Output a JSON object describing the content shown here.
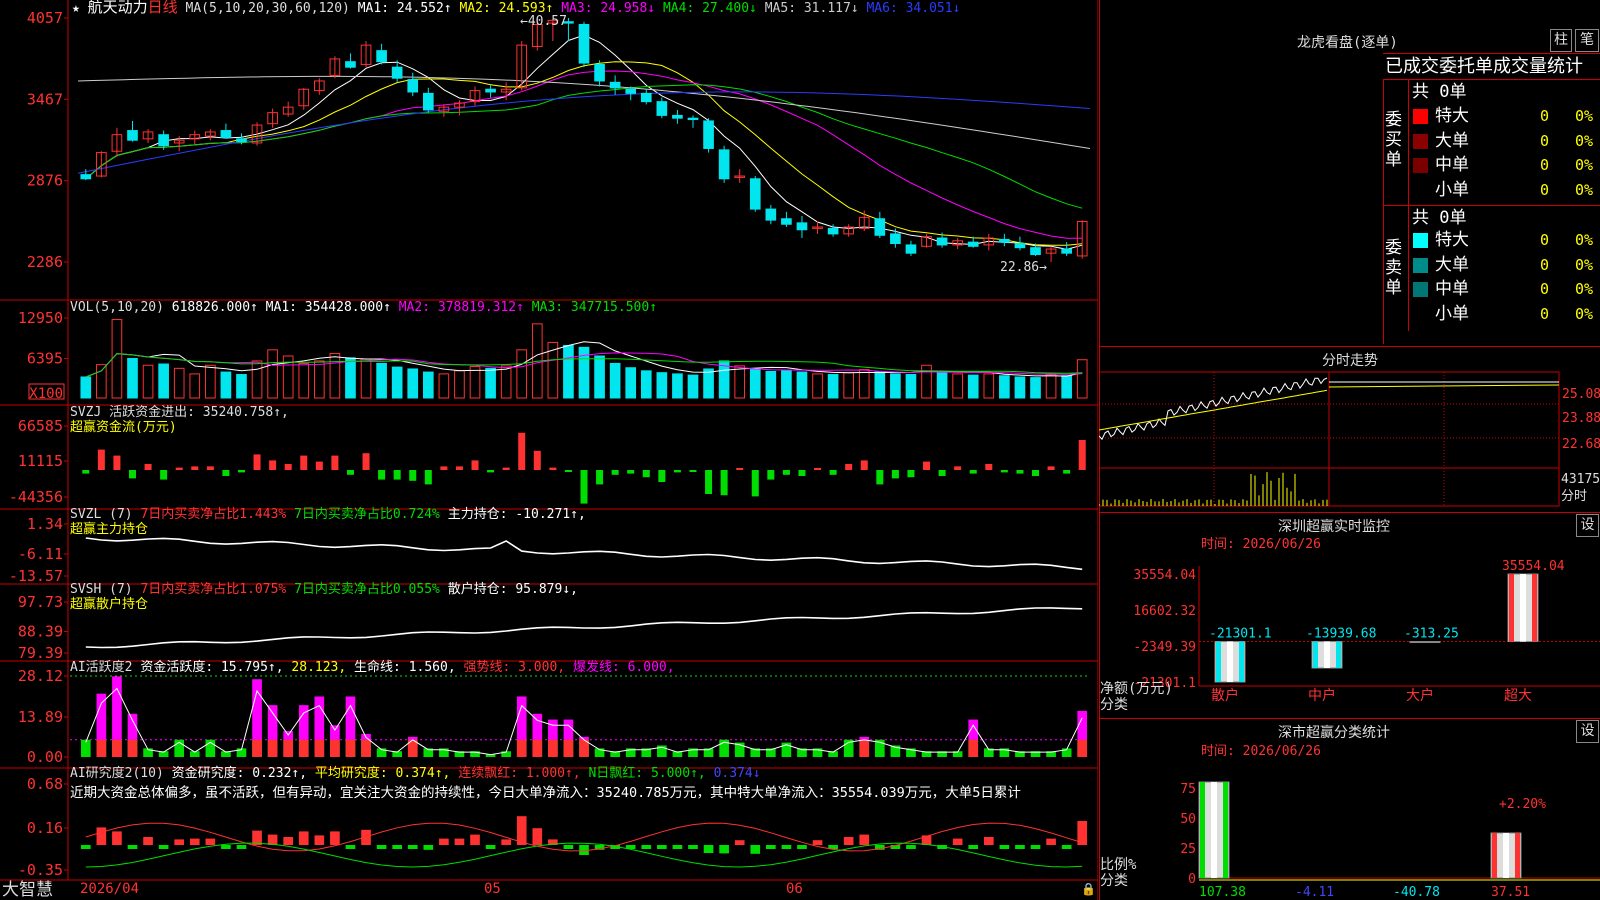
{
  "colors": {
    "up": "#ff3232",
    "down": "#00e5ee",
    "axis": "#c80000",
    "green": "#00dd00",
    "magenta": "#ff00ff",
    "yellow": "#ffff00",
    "white": "#ffffff",
    "blue": "#2a3cff"
  },
  "main": {
    "star": "★",
    "stock_name": "航天动力",
    "period": "日线",
    "ma_header": "MA(5,10,20,30,60,120)",
    "ma_values": [
      {
        "label": "MA1: 24.552↑",
        "color": "#ffffff"
      },
      {
        "label": "MA2: 24.593↑",
        "color": "#ffff00"
      },
      {
        "label": "MA3: 24.958↓",
        "color": "#ff00ff"
      },
      {
        "label": "MA4: 27.400↓",
        "color": "#00dd00"
      },
      {
        "label": "MA5: 31.117↓",
        "color": "#cccccc"
      },
      {
        "label": "MA6: 34.051↓",
        "color": "#2a3cff"
      }
    ],
    "high_annot": "←40.57",
    "low_annot": "22.86→",
    "yticks": [
      "4057",
      "3467",
      "2876",
      "2286"
    ]
  },
  "vol": {
    "header": "VOL(5,10,20)",
    "value": "618826.000↑",
    "ma": [
      {
        "label": "MA1: 354428.000↑",
        "color": "#ffffff"
      },
      {
        "label": "MA2: 378819.312↑",
        "color": "#ff00ff"
      },
      {
        "label": "MA3: 347715.500↑",
        "color": "#00dd00"
      }
    ],
    "yticks": [
      "12950",
      "6395"
    ],
    "unit": "X100"
  },
  "svzj": {
    "header": "SVZJ  活跃资金进出: 35240.758↑,",
    "sub": "超赢资金流(万元)",
    "yticks": [
      "66585",
      "11115",
      "-44356"
    ]
  },
  "svzl": {
    "header_a": "SVZL (7)",
    "header_b": "7日内买卖净占比1.443%",
    "header_c": "7日内买卖净占比0.724%",
    "header_d": "主力持仓: -10.271↑,",
    "sub": "超赢主力持仓",
    "yticks": [
      "1.34",
      "-6.11",
      "-13.57"
    ]
  },
  "svsh": {
    "header_a": "SVSH (7)",
    "header_b": "7日内买卖净占比1.075%",
    "header_c": "7日内买卖净占比0.055%",
    "header_d": "散户持仓: 95.879↓,",
    "sub": "超赢散户持仓",
    "yticks": [
      "97.73",
      "88.39",
      "79.39"
    ]
  },
  "ai1": {
    "header_a": "AI活跃度2",
    "header_b": "资金活跃度: 15.795↑,",
    "header_c": "28.123,",
    "header_d": "生命线: 1.560,",
    "header_e": "强势线: 3.000,",
    "header_f": "爆发线: 6.000,",
    "yticks": [
      "28.12",
      "13.89",
      "0.00"
    ]
  },
  "ai2": {
    "header_a": "AI研究度2(10)",
    "header_b": "资金研究度: 0.232↑,",
    "header_c": "平均研究度: 0.374↑,",
    "header_d": "连续飘红: 1.000↑,",
    "header_e": "N日飘红: 5.000↑,",
    "header_f": "0.374↓",
    "comment": "近期大资金总体偏多，虽不活跃，但有异动，宜关注大资金的持续性，今日大单净流入：35240.785万元，其中特大单净流入：35554.039万元，大单5日累计",
    "yticks": [
      "0.68",
      "0.16",
      "-0.35"
    ]
  },
  "bottom": {
    "logo": "大智慧",
    "date_labels": [
      "2026/04",
      "05",
      "06"
    ]
  },
  "right": {
    "dragon": {
      "title": "龙虎看盘(逐单)",
      "btn1": "柱",
      "btn2": "笔",
      "subtitle": "已成交委托单成交量统计",
      "buy_label": "委买单",
      "sell_label": "委卖单",
      "buy_total": "共 0单",
      "sell_total": "共 0单",
      "rows": [
        {
          "name": "特大",
          "count": "0",
          "pct": "0%"
        },
        {
          "name": "大单",
          "count": "0",
          "pct": "0%"
        },
        {
          "name": "中单",
          "count": "0",
          "pct": "0%"
        },
        {
          "name": "小单",
          "count": "0",
          "pct": "0%"
        }
      ]
    },
    "intraday": {
      "title": "分时走势",
      "yticks": [
        "25.08",
        "23.88",
        "22.68"
      ],
      "vol_label": "43175",
      "vol_unit": "分时"
    },
    "sz_monitor": {
      "title": "深圳超赢实时监控",
      "btn": "设",
      "time": "时间: 2026/06/26",
      "yticks": [
        "35554.04",
        "16602.32",
        "-2349.39",
        "-21301.1"
      ],
      "ylabel": "净额(万元)",
      "xlabel": "分类",
      "chart_data": {
        "type": "bar",
        "categories": [
          "散户",
          "中户",
          "大户",
          "超大"
        ],
        "values": [
          -21301.1,
          -13939.68,
          -313.25,
          35554.04
        ],
        "value_labels": [
          "-21301.1",
          "-13939.68",
          "-313.25",
          "35554.04"
        ],
        "ylim": [
          -21301.1,
          35554.04
        ]
      }
    },
    "sz_class": {
      "title": "深市超赢分类统计",
      "btn": "设",
      "time": "时间: 2026/06/26",
      "yticks": [
        "75",
        "50",
        "25",
        "0"
      ],
      "ylabel": "比例%",
      "xlabel": "分类",
      "pct_annot": "+2.20%",
      "chart_data": {
        "type": "bar",
        "categories": [
          "散户",
          "中户",
          "大户",
          "超大"
        ],
        "values": [
          107.38,
          -4.11,
          -40.78,
          37.51
        ],
        "value_labels": [
          "107.38",
          "-4.11",
          "-40.78",
          "37.51"
        ],
        "ylim": [
          0,
          75
        ]
      }
    }
  },
  "chart_data": {
    "type": "candlestick",
    "title": "航天动力 日线",
    "ylim": [
      22.86,
      40.57
    ],
    "annotations": [
      "←40.57",
      "22.86→"
    ],
    "x_labels": [
      "2026/04",
      "05",
      "06"
    ],
    "ohlc": [
      [
        29.2,
        29.6,
        28.8,
        28.9
      ],
      [
        29.1,
        30.9,
        29.0,
        30.8
      ],
      [
        30.9,
        32.6,
        30.5,
        32.1
      ],
      [
        32.4,
        33.1,
        31.6,
        31.7
      ],
      [
        31.8,
        32.5,
        31.5,
        32.3
      ],
      [
        32.1,
        32.4,
        31.0,
        31.3
      ],
      [
        31.5,
        32.0,
        30.9,
        31.7
      ],
      [
        31.8,
        32.4,
        31.4,
        32.1
      ],
      [
        32.0,
        32.5,
        31.7,
        32.3
      ],
      [
        32.4,
        32.9,
        31.8,
        31.9
      ],
      [
        31.8,
        32.2,
        31.4,
        31.6
      ],
      [
        31.5,
        33.0,
        31.3,
        32.8
      ],
      [
        32.9,
        34.0,
        32.6,
        33.7
      ],
      [
        33.6,
        34.5,
        33.4,
        34.1
      ],
      [
        34.2,
        35.5,
        33.9,
        35.4
      ],
      [
        35.3,
        36.2,
        35.0,
        36.0
      ],
      [
        36.4,
        37.8,
        36.2,
        37.6
      ],
      [
        37.4,
        38.0,
        36.9,
        37.0
      ],
      [
        37.2,
        38.9,
        37.0,
        38.6
      ],
      [
        38.2,
        38.7,
        37.2,
        37.4
      ],
      [
        37.0,
        37.5,
        35.9,
        36.2
      ],
      [
        36.1,
        36.6,
        34.9,
        35.2
      ],
      [
        35.1,
        35.5,
        33.7,
        33.9
      ],
      [
        33.8,
        34.3,
        33.4,
        34.1
      ],
      [
        34.1,
        34.6,
        33.5,
        34.4
      ],
      [
        34.5,
        35.6,
        34.2,
        35.3
      ],
      [
        35.4,
        35.7,
        34.8,
        35.2
      ],
      [
        35.2,
        35.9,
        34.6,
        35.4
      ],
      [
        35.5,
        38.9,
        35.3,
        38.6
      ],
      [
        38.5,
        40.3,
        38.2,
        40.1
      ],
      [
        40.2,
        40.5,
        38.9,
        40.4
      ],
      [
        40.3,
        40.57,
        38.9,
        40.2
      ],
      [
        40.1,
        40.3,
        37.0,
        37.3
      ],
      [
        37.2,
        37.5,
        35.6,
        36.0
      ],
      [
        35.9,
        36.4,
        35.0,
        35.5
      ],
      [
        35.4,
        35.6,
        34.6,
        35.1
      ],
      [
        35.1,
        35.4,
        34.3,
        34.5
      ],
      [
        34.5,
        34.8,
        33.3,
        33.5
      ],
      [
        33.5,
        33.9,
        32.9,
        33.3
      ],
      [
        33.3,
        33.5,
        32.6,
        33.2
      ],
      [
        33.1,
        33.3,
        30.8,
        31.1
      ],
      [
        31.0,
        31.3,
        28.6,
        28.9
      ],
      [
        29.0,
        29.6,
        28.6,
        29.1
      ],
      [
        28.9,
        29.1,
        26.5,
        26.7
      ],
      [
        26.7,
        27.0,
        25.6,
        25.9
      ],
      [
        26.0,
        26.5,
        25.4,
        25.6
      ],
      [
        25.7,
        26.2,
        24.6,
        25.2
      ],
      [
        25.3,
        25.8,
        24.9,
        25.4
      ],
      [
        25.3,
        25.6,
        24.7,
        24.9
      ],
      [
        24.9,
        25.6,
        24.7,
        25.4
      ],
      [
        25.3,
        26.6,
        25.1,
        26.1
      ],
      [
        26.0,
        26.5,
        24.6,
        24.8
      ],
      [
        24.9,
        25.3,
        23.9,
        24.2
      ],
      [
        24.1,
        24.4,
        23.3,
        23.5
      ],
      [
        24.0,
        24.9,
        23.9,
        24.7
      ],
      [
        24.6,
        25.0,
        23.9,
        24.1
      ],
      [
        24.1,
        24.6,
        23.8,
        24.4
      ],
      [
        24.3,
        24.7,
        23.9,
        24.0
      ],
      [
        24.1,
        24.9,
        23.7,
        24.6
      ],
      [
        24.5,
        24.9,
        24.0,
        24.3
      ],
      [
        24.2,
        24.7,
        23.7,
        23.9
      ],
      [
        23.9,
        24.2,
        23.3,
        23.4
      ],
      [
        23.5,
        24.0,
        22.86,
        23.8
      ],
      [
        23.8,
        24.3,
        23.3,
        23.5
      ],
      [
        23.3,
        25.9,
        23.1,
        25.8
      ]
    ],
    "volumes": [
      3400,
      5400,
      12700,
      6400,
      5300,
      5500,
      4800,
      3900,
      5300,
      4200,
      3800,
      6000,
      7800,
      6800,
      5600,
      6000,
      7200,
      6500,
      6300,
      5600,
      5000,
      4700,
      4200,
      3900,
      4400,
      5100,
      4800,
      5200,
      7800,
      12000,
      9000,
      8500,
      8200,
      6800,
      5600,
      4900,
      4400,
      4100,
      3900,
      3700,
      4700,
      6000,
      5200,
      4600,
      4300,
      4500,
      4200,
      3900,
      3800,
      4100,
      4600,
      4200,
      3900,
      3800,
      5300,
      4100,
      3900,
      3700,
      3900,
      3600,
      3400,
      3300,
      3800,
      3600,
      6195
    ]
  }
}
